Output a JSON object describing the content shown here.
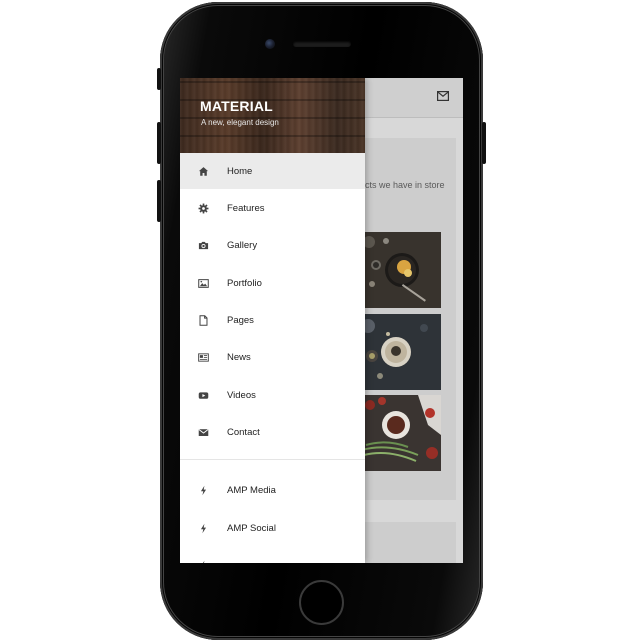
{
  "drawer": {
    "title": "MATERIAL",
    "subtitle": "A new, elegant design",
    "items": [
      {
        "label": "Home",
        "icon": "home-icon",
        "active": true
      },
      {
        "label": "Features",
        "icon": "gear-icon"
      },
      {
        "label": "Gallery",
        "icon": "camera-icon"
      },
      {
        "label": "Portfolio",
        "icon": "image-icon"
      },
      {
        "label": "Pages",
        "icon": "file-icon"
      },
      {
        "label": "News",
        "icon": "newspaper-icon"
      },
      {
        "label": "Videos",
        "icon": "youtube-icon"
      },
      {
        "label": "Contact",
        "icon": "envelope-icon"
      }
    ],
    "amp_items": [
      {
        "label": "AMP Media",
        "icon": "bolt-icon"
      },
      {
        "label": "AMP Social",
        "icon": "bolt-icon"
      }
    ]
  },
  "page": {
    "text_fragment": "cts we have in store",
    "header_icon": "envelope-icon"
  },
  "colors": {
    "drawer_bg": "#ffffff",
    "active_item_bg": "#ebebeb",
    "overlay": "#d8d8d8"
  }
}
